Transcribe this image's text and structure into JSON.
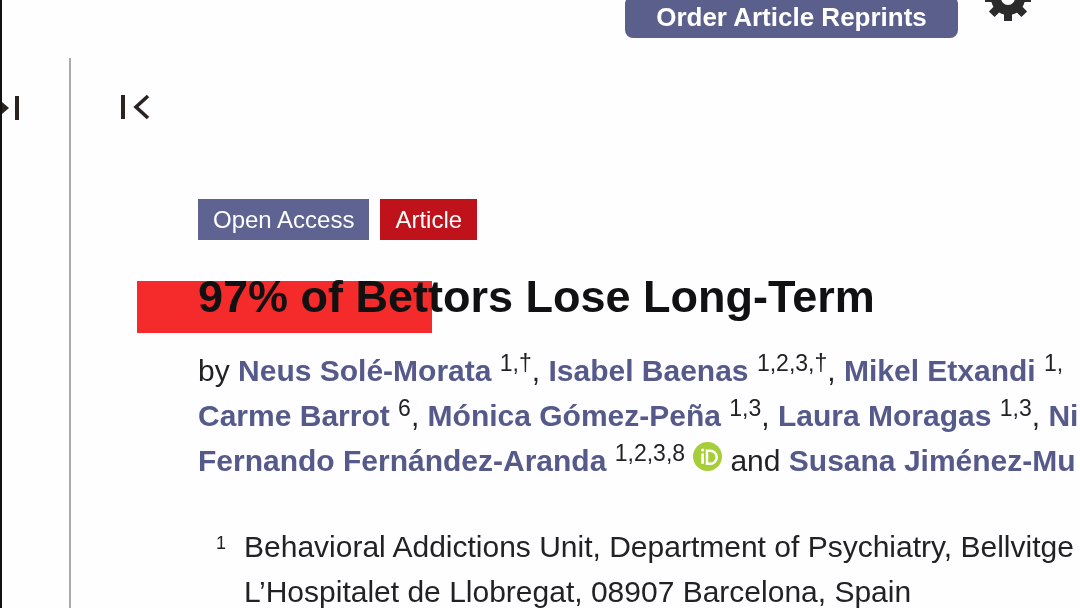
{
  "header": {
    "reprint_button": "Order Article Reprints"
  },
  "badges": [
    {
      "label": "Open Access",
      "color": "#5f6391"
    },
    {
      "label": "Article",
      "color": "#c0121b"
    }
  ],
  "title": {
    "text": "97% of Bettors Lose Long-Term",
    "highlighted": true
  },
  "byline": {
    "lines": [
      [
        {
          "kind": "word",
          "text": "by"
        },
        {
          "kind": "author",
          "name": "Neus Solé-Morata",
          "marks": "1,†",
          "orcid": false,
          "punct": ","
        },
        {
          "kind": "author",
          "name": "Isabel Baenas",
          "marks": "1,2,3,†",
          "orcid": false,
          "punct": ","
        },
        {
          "kind": "author",
          "name": "Mikel Etxandi",
          "marks": "1,",
          "orcid": false
        }
      ],
      [
        {
          "kind": "author",
          "name": "Carme Barrot",
          "marks": "6",
          "orcid": false,
          "punct": ","
        },
        {
          "kind": "author",
          "name": "Mónica Gómez-Peña",
          "marks": "1,3",
          "orcid": false,
          "punct": ","
        },
        {
          "kind": "author",
          "name": "Laura Moragas",
          "marks": "1,3",
          "orcid": false,
          "punct": ","
        },
        {
          "kind": "author",
          "name": "Ni",
          "orcid": false
        }
      ],
      [
        {
          "kind": "author",
          "name": "Fernando Fernández-Aranda",
          "marks": "1,2,3,8",
          "orcid": true
        },
        {
          "kind": "word",
          "text": "and"
        },
        {
          "kind": "author",
          "name": "Susana Jiménez-Mu",
          "orcid": false
        }
      ]
    ]
  },
  "affiliations": [
    {
      "mark": "1",
      "lines": [
        "Behavioral Addictions Unit, Department of Psychiatry, Bellvitge",
        "L’Hospitalet de Llobregat, 08907 Barcelona, Spain"
      ]
    }
  ]
}
